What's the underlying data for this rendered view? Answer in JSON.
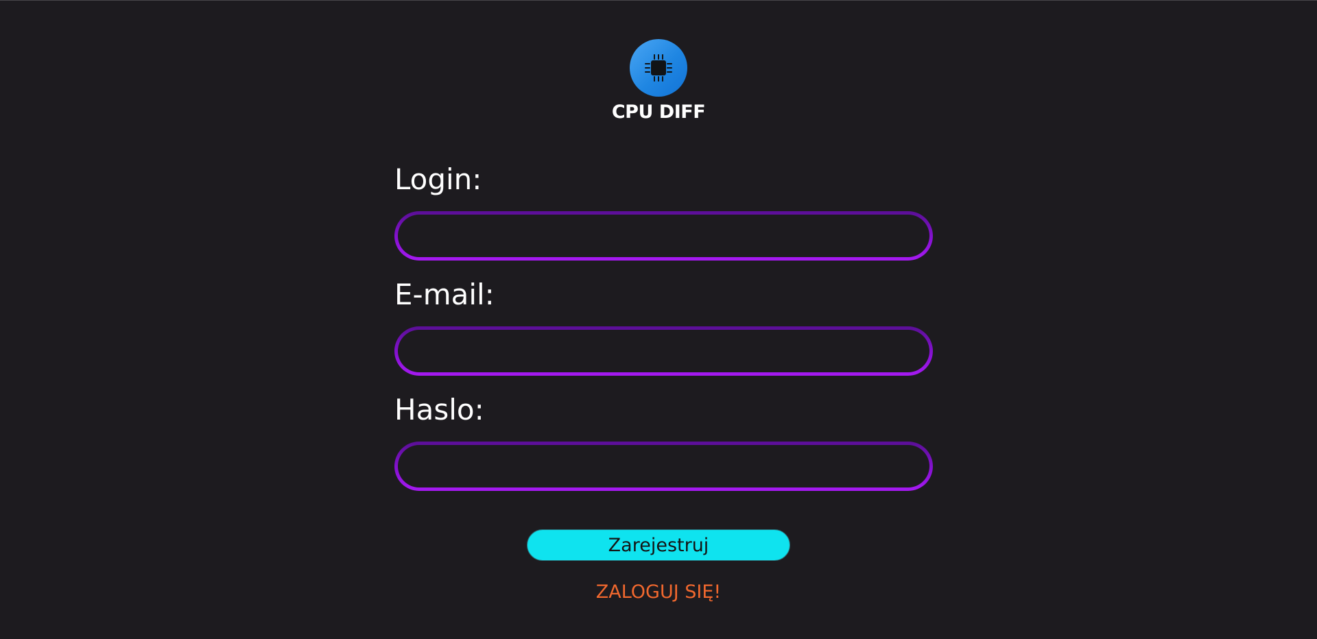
{
  "brand": {
    "name": "CPU DIFF",
    "icon": "cpu-chip-icon",
    "color_start": "#4aa6f4",
    "color_end": "#1273d6"
  },
  "form": {
    "fields": [
      {
        "label": "Login:",
        "value": "",
        "placeholder": ""
      },
      {
        "label": "E-mail:",
        "value": "",
        "placeholder": ""
      },
      {
        "label": "Haslo:",
        "value": "",
        "placeholder": ""
      }
    ],
    "input_border_color": "#a61af2",
    "submit_label": "Zarejestruj",
    "submit_color": "#0fe3ef"
  },
  "login_link": {
    "label": "ZALOGUJ SIĘ!",
    "color": "#f1682e"
  },
  "background_color": "#1d1b1f"
}
